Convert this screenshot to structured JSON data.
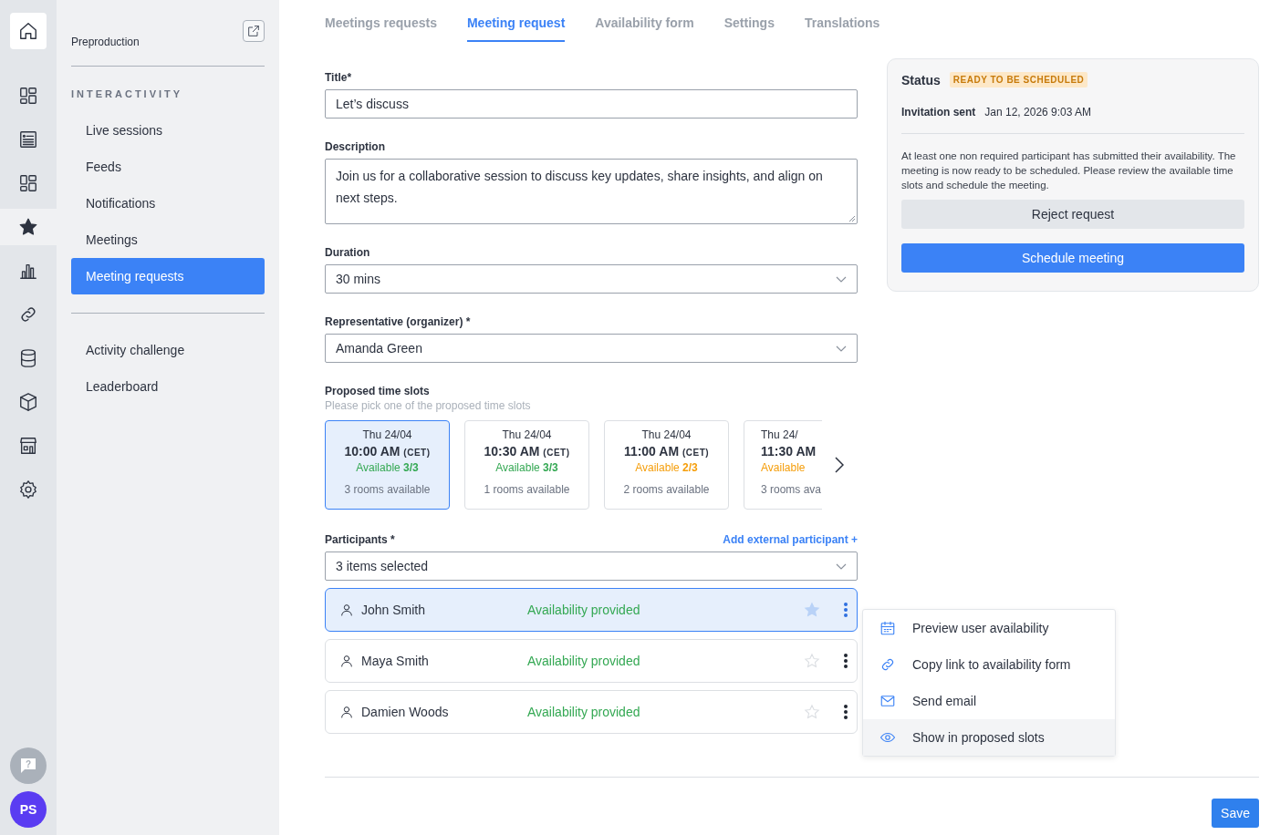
{
  "rail": {
    "home": {
      "selected": false
    },
    "items": [
      {
        "selected": false
      },
      {
        "selected": false
      },
      {
        "selected": false
      },
      {
        "selected": true
      },
      {
        "selected": false
      },
      {
        "selected": false
      },
      {
        "selected": false
      },
      {
        "selected": false
      },
      {
        "selected": false
      },
      {
        "selected": false
      }
    ],
    "help": "?",
    "avatar": "PS"
  },
  "sidebar": {
    "environment": "Preproduction",
    "groups": [
      {
        "title": "INTERACTIVITY",
        "items": [
          {
            "label": "Live sessions",
            "selected": false
          },
          {
            "label": "Feeds",
            "selected": false
          },
          {
            "label": "Notifications",
            "selected": false
          },
          {
            "label": "Meetings",
            "selected": false
          },
          {
            "label": "Meeting requests",
            "selected": true
          }
        ]
      },
      {
        "items": [
          {
            "label": "Activity challenge",
            "selected": false
          },
          {
            "label": "Leaderboard",
            "selected": false
          }
        ]
      }
    ]
  },
  "tabs": [
    {
      "label": "Meetings requests",
      "selected": false
    },
    {
      "label": "Meeting request",
      "selected": true
    },
    {
      "label": "Availability form",
      "selected": false
    },
    {
      "label": "Settings",
      "selected": false
    },
    {
      "label": "Translations",
      "selected": false
    }
  ],
  "form": {
    "title": {
      "label": "Title*",
      "value": "Let’s discuss"
    },
    "description": {
      "label": "Description",
      "value": "Join us for a collaborative session to discuss key updates, share insights, and align on next steps."
    },
    "duration": {
      "label": "Duration",
      "value": "30 mins"
    },
    "representative": {
      "label": "Representative (organizer) *",
      "value": "Amanda Green"
    },
    "time_slots": {
      "label": "Proposed time slots",
      "hint": "Please pick one of the proposed time slots",
      "items": [
        {
          "date": "Thu 24/04",
          "time": "10:00 AM",
          "zone": "(CET)",
          "availability": "Available",
          "count": "3/3",
          "color": "#34a853",
          "rooms": "3 rooms available",
          "selected": true,
          "cut_off": false
        },
        {
          "date": "Thu 24/04",
          "time": "10:30 AM",
          "zone": "(CET)",
          "availability": "Available",
          "count": "3/3",
          "color": "#34a853",
          "rooms": "1 rooms available",
          "selected": false,
          "cut_off": false
        },
        {
          "date": "Thu 24/04",
          "time": "11:00 AM",
          "zone": "(CET)",
          "availability": "Available",
          "count": "2/3",
          "color": "#f59e0b",
          "rooms": "2 rooms available",
          "selected": false,
          "cut_off": false
        },
        {
          "date": "Thu 24/",
          "time": "11:30 AM",
          "availability": "Available",
          "color": "#f59e0b",
          "rooms": "3 rooms ava",
          "selected": false,
          "cut_off": true
        }
      ]
    },
    "participants": {
      "label": "Participants *",
      "add_link": "Add external participant +",
      "value": "3 items selected",
      "rows": [
        {
          "name": "John Smith",
          "status": "Availability provided",
          "selected": true
        },
        {
          "name": "Maya Smith",
          "status": "Availability provided",
          "selected": false
        },
        {
          "name": "Damien Woods",
          "status": "Availability provided",
          "selected": false
        }
      ]
    }
  },
  "context_menu": {
    "items": [
      {
        "kind": "calendar",
        "label": "Preview user availability",
        "selected": false
      },
      {
        "kind": "link",
        "label": "Copy link to availability form",
        "selected": false
      },
      {
        "kind": "email",
        "label": "Send email",
        "selected": false
      },
      {
        "kind": "eye",
        "label": "Show in proposed slots",
        "selected": true
      }
    ]
  },
  "status_panel": {
    "title": "Status",
    "badge": "READY TO BE SCHEDULED",
    "invitation_label": "Invitation sent",
    "invitation_value": "Jan 12, 2026 9:03 AM",
    "message": "At least one non required participant has submitted their availability. The meeting is now ready to be scheduled. Please review the available time slots and schedule the meeting.",
    "buttons": [
      {
        "label": "Reject request",
        "kind": "secondary"
      },
      {
        "label": "Schedule meeting",
        "kind": "primary"
      }
    ]
  },
  "footer": {
    "save": "Save"
  }
}
